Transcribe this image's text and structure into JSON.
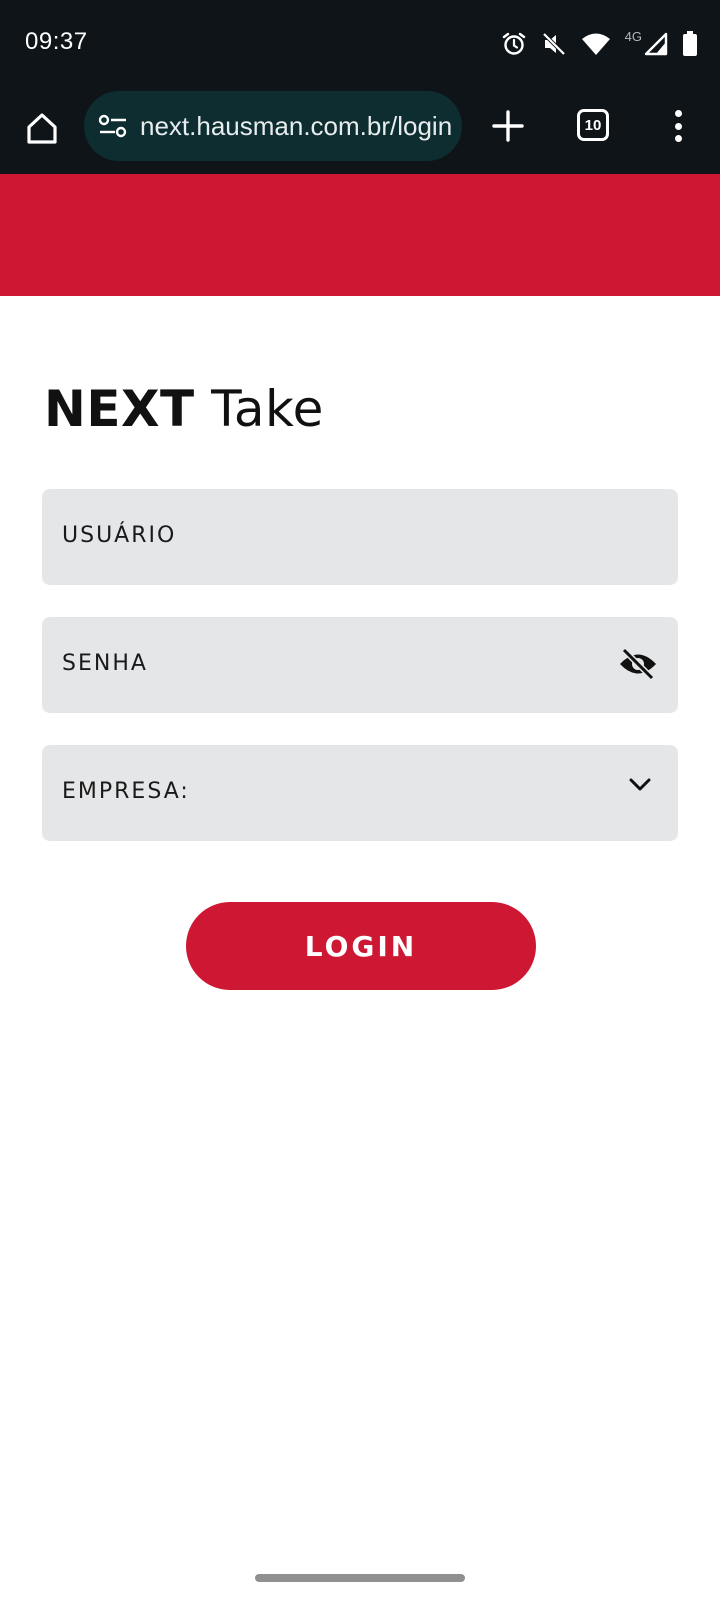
{
  "status_bar": {
    "time": "09:37",
    "network_label": "4G",
    "icons": [
      "alarm-icon",
      "mute-icon",
      "wifi-icon",
      "signal-icon",
      "battery-icon"
    ]
  },
  "browser": {
    "url": "next.hausman.com.br/login",
    "tab_count": "10",
    "icons": [
      "home-icon",
      "site-settings-icon",
      "new-tab-icon",
      "tabs-icon",
      "menu-icon"
    ]
  },
  "page": {
    "title_bold": "NEXT",
    "title_regular": " Take",
    "username_label": "USUÁRIO",
    "password_label": "SENHA",
    "company_label": "EMPRESA:",
    "login_label": "LOGIN"
  },
  "colors": {
    "brand_red": "#cd1733",
    "field_bg": "#e5e6e8",
    "status_bar_bg": "#0f1418",
    "url_bar_bg": "#0d2d31"
  }
}
